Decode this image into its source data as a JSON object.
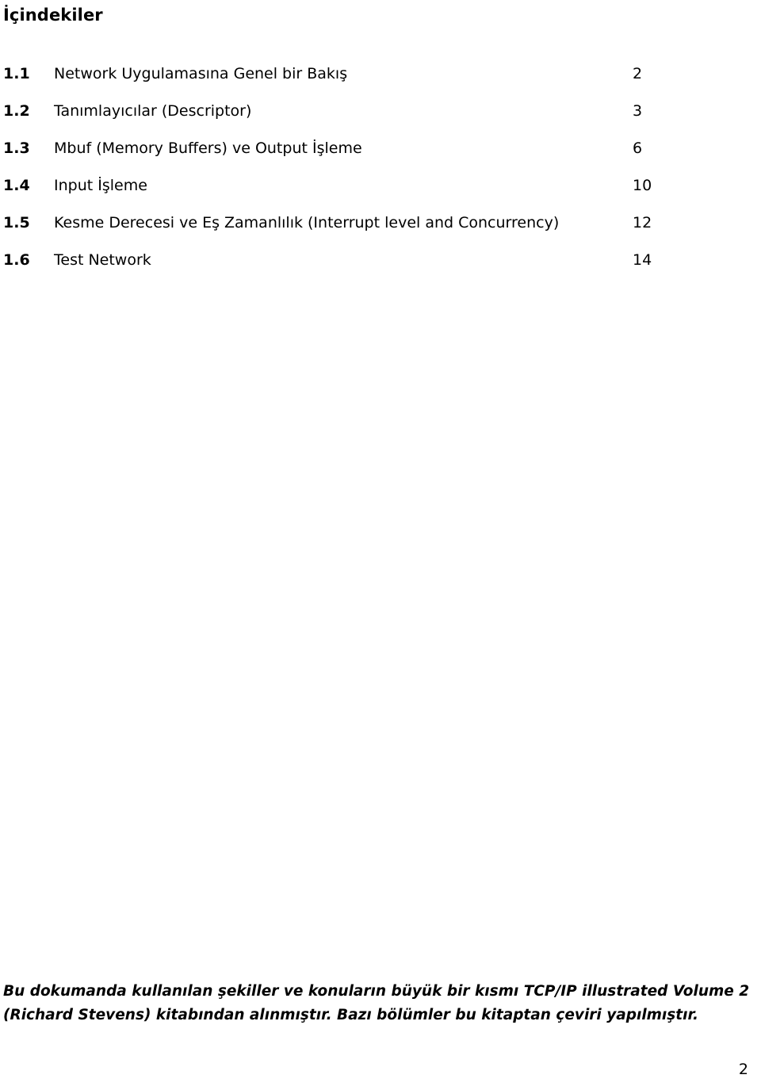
{
  "document": {
    "title": "İçindekiler",
    "page_number": "2"
  },
  "toc": {
    "entries": [
      {
        "number": "1.1",
        "label": "Network Uygulamasına Genel bir Bakış",
        "page": "2"
      },
      {
        "number": "1.2",
        "label": "Tanımlayıcılar (Descriptor)",
        "page": "3"
      },
      {
        "number": "1.3",
        "label": "Mbuf (Memory Buffers) ve Output İşleme",
        "page": "6"
      },
      {
        "number": "1.4",
        "label": "Input İşleme",
        "page": "10"
      },
      {
        "number": "1.5",
        "label": "Kesme Derecesi ve Eş Zamanlılık (Interrupt level and Concurrency)",
        "page": "12"
      },
      {
        "number": "1.6",
        "label": "Test Network",
        "page": "14"
      }
    ]
  },
  "footnote": {
    "line1": "Bu dokumanda kullanılan şekiller ve konuların büyük bir kısmı TCP/IP illustrated Volume 2",
    "line2": "(Richard Stevens) kitabından alınmıştır. Bazı bölümler bu  kitaptan çeviri yapılmıştır."
  }
}
